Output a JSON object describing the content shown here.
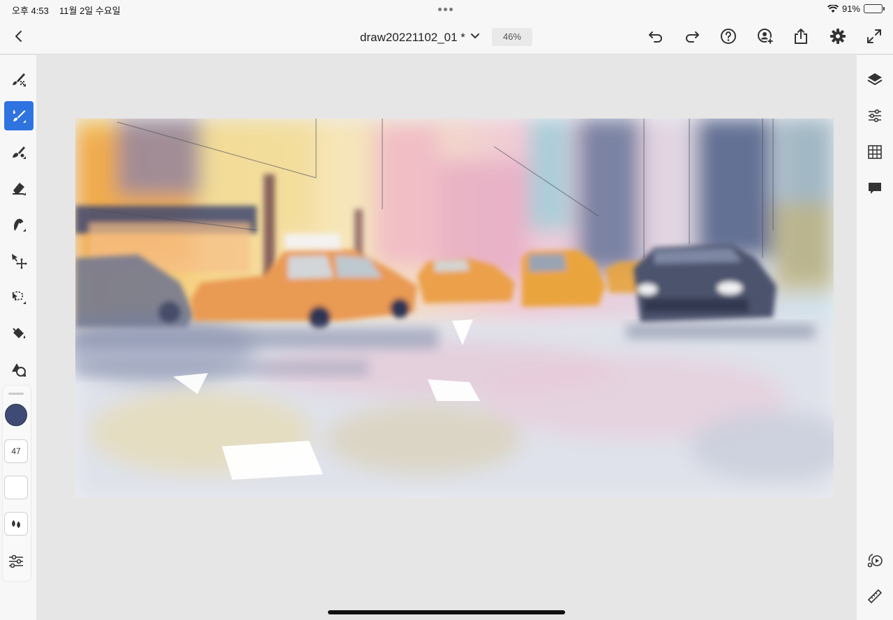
{
  "status_bar": {
    "time": "오후 4:53",
    "date": "11월 2일 수요일",
    "battery_percent": "91%",
    "battery_level": 0.91,
    "icons": [
      "wifi-icon",
      "battery-icon",
      "multitask-dots-icon"
    ]
  },
  "toolbar": {
    "document_name": "draw20221102_01 *",
    "zoom_level": "46%",
    "icons": [
      "back-icon",
      "chevron-down-icon",
      "undo-icon",
      "redo-icon",
      "help-icon",
      "invite-icon",
      "share-icon",
      "settings-icon",
      "fullscreen-icon"
    ]
  },
  "tools": [
    {
      "name": "pixel-brush",
      "icon": "pixel-brush-icon",
      "active": false
    },
    {
      "name": "live-brush",
      "icon": "live-brush-icon",
      "active": true
    },
    {
      "name": "vector-brush",
      "icon": "vector-brush-icon",
      "active": false
    },
    {
      "name": "eraser",
      "icon": "eraser-icon",
      "active": false
    },
    {
      "name": "smudge",
      "icon": "smudge-icon",
      "active": false
    },
    {
      "name": "transform",
      "icon": "transform-icon",
      "active": false
    },
    {
      "name": "selection",
      "icon": "lasso-icon",
      "active": false
    },
    {
      "name": "fill",
      "icon": "fill-icon",
      "active": false
    },
    {
      "name": "shapes",
      "icon": "shapes-icon",
      "active": false
    }
  ],
  "brush_properties": {
    "color": "#3f4b74",
    "size": "47",
    "opacity_icon": "opacity-swatch-icon",
    "flow_icon": "water-flow-icon",
    "settings_icon": "brush-settings-icon"
  },
  "right_panel": {
    "icons": [
      "layers-icon",
      "adjustments-icon",
      "grid-icon",
      "comments-icon",
      "timelapse-icon",
      "ruler-icon"
    ]
  },
  "accent_color": "#2f73e0"
}
